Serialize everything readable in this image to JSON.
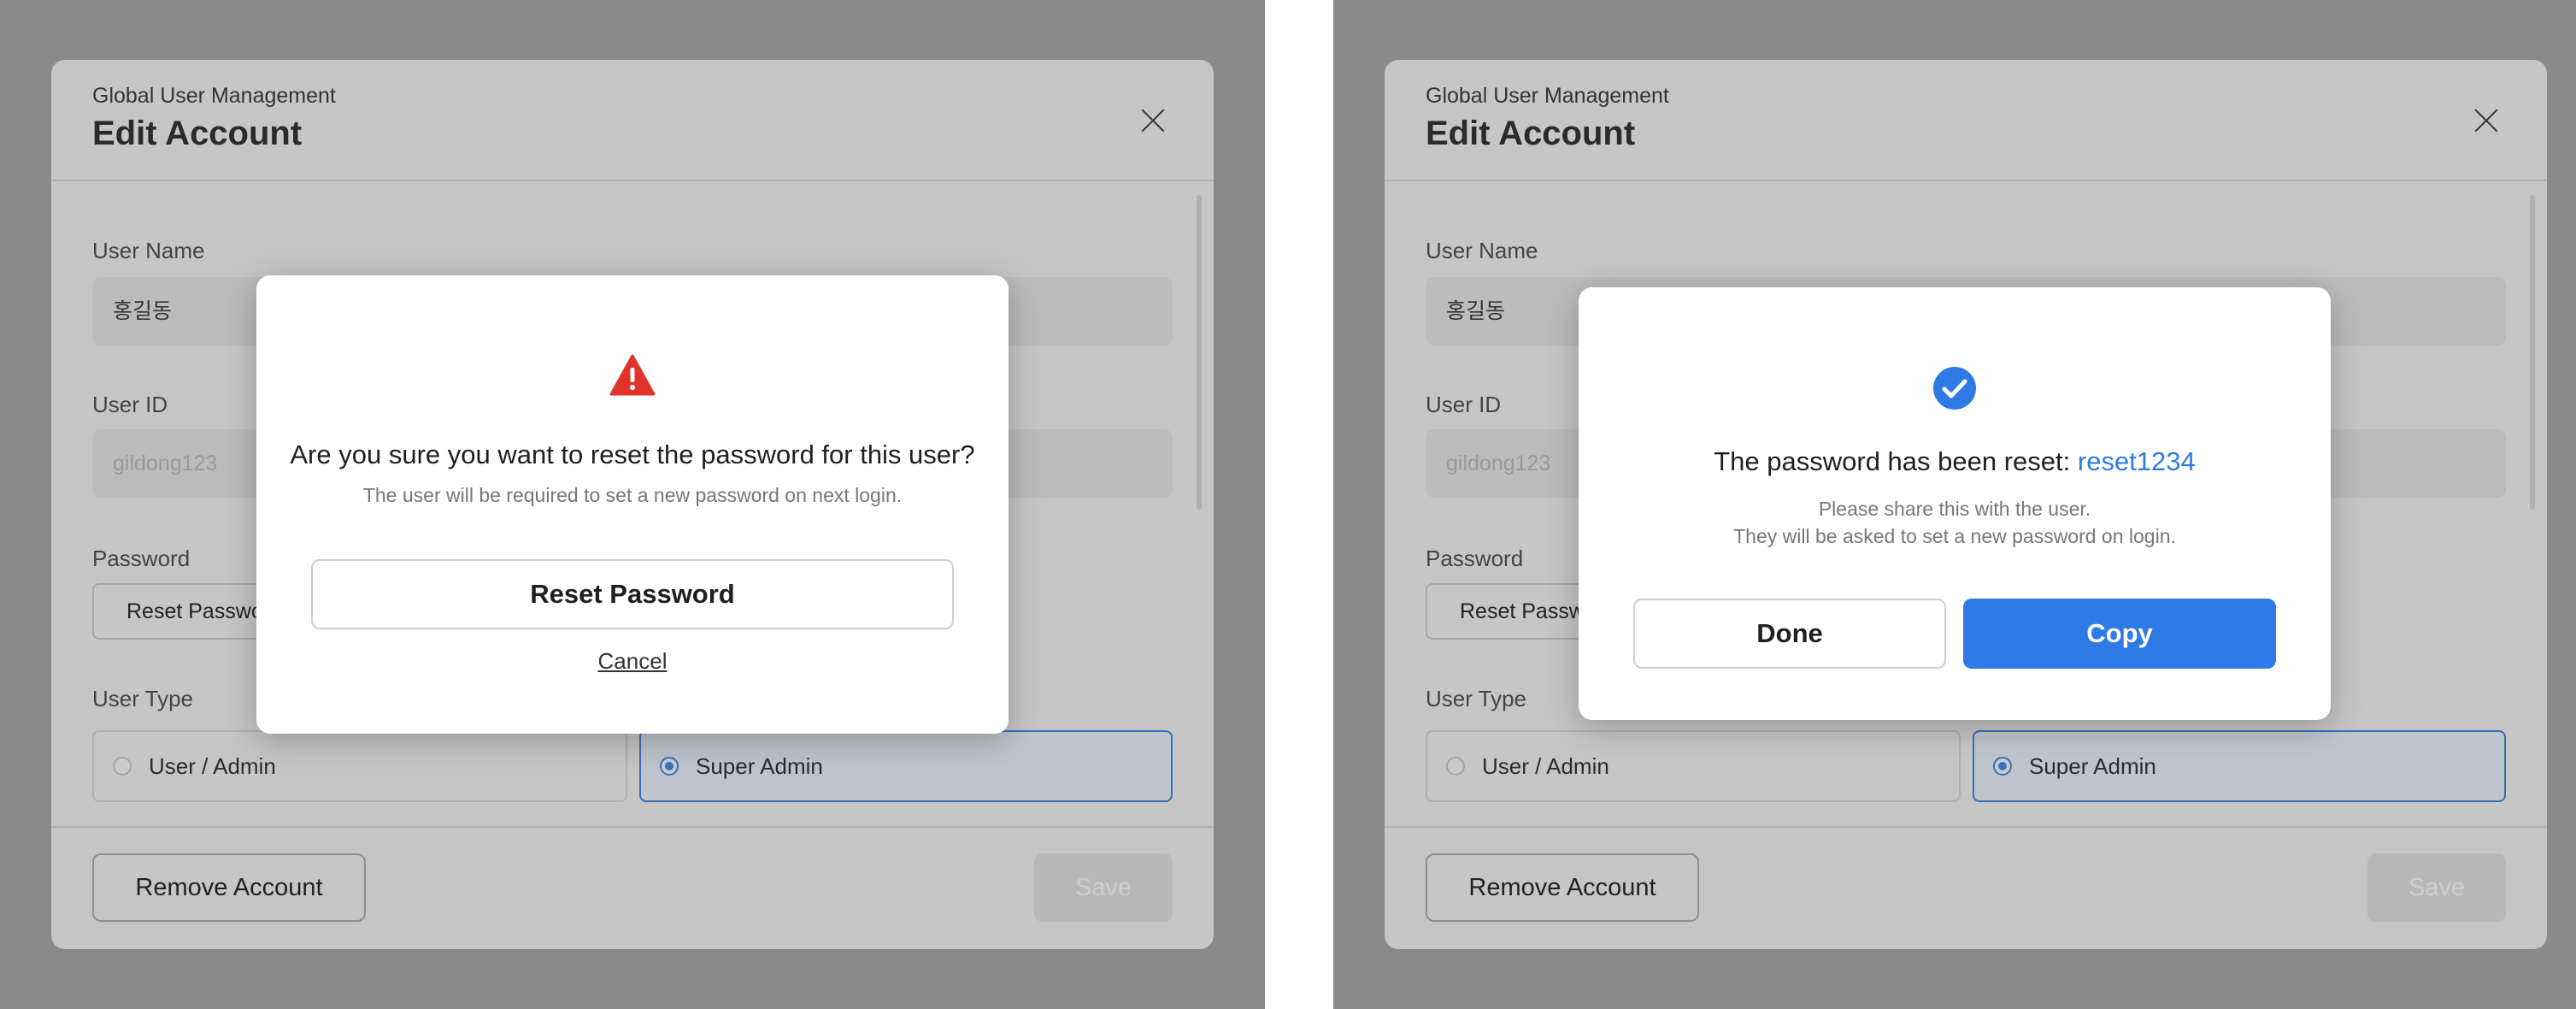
{
  "account_form": {
    "sup_title": "Global User Management",
    "title": "Edit Account",
    "user_name_label": "User Name",
    "user_name_value": "홍길동",
    "user_id_label": "User ID",
    "user_id_value": "gildong123",
    "password_label": "Password",
    "reset_password_button": "Reset Password",
    "user_type_label": "User Type",
    "user_type_options": [
      "User / Admin",
      "Super Admin"
    ],
    "user_type_selected": "Super Admin",
    "remove_button": "Remove Account",
    "save_button": "Save"
  },
  "confirm_modal": {
    "heading": "Are you sure you want to reset the password for this user?",
    "subtext": "The user will be required to set a new password on next login.",
    "reset_button": "Reset Password",
    "cancel_link": "Cancel",
    "icon": "warning-icon"
  },
  "done_modal": {
    "heading_prefix": "The password has been reset: ",
    "new_password": "reset1234",
    "sub_line1": "Please share this with the user.",
    "sub_line2": "They will be asked to set a new password on login.",
    "done_button": "Done",
    "copy_button": "Copy",
    "icon": "check-circle-icon"
  },
  "colors": {
    "overlay": "#8a8a8a",
    "accent": "#2f7be6",
    "warning": "#e0342b"
  }
}
